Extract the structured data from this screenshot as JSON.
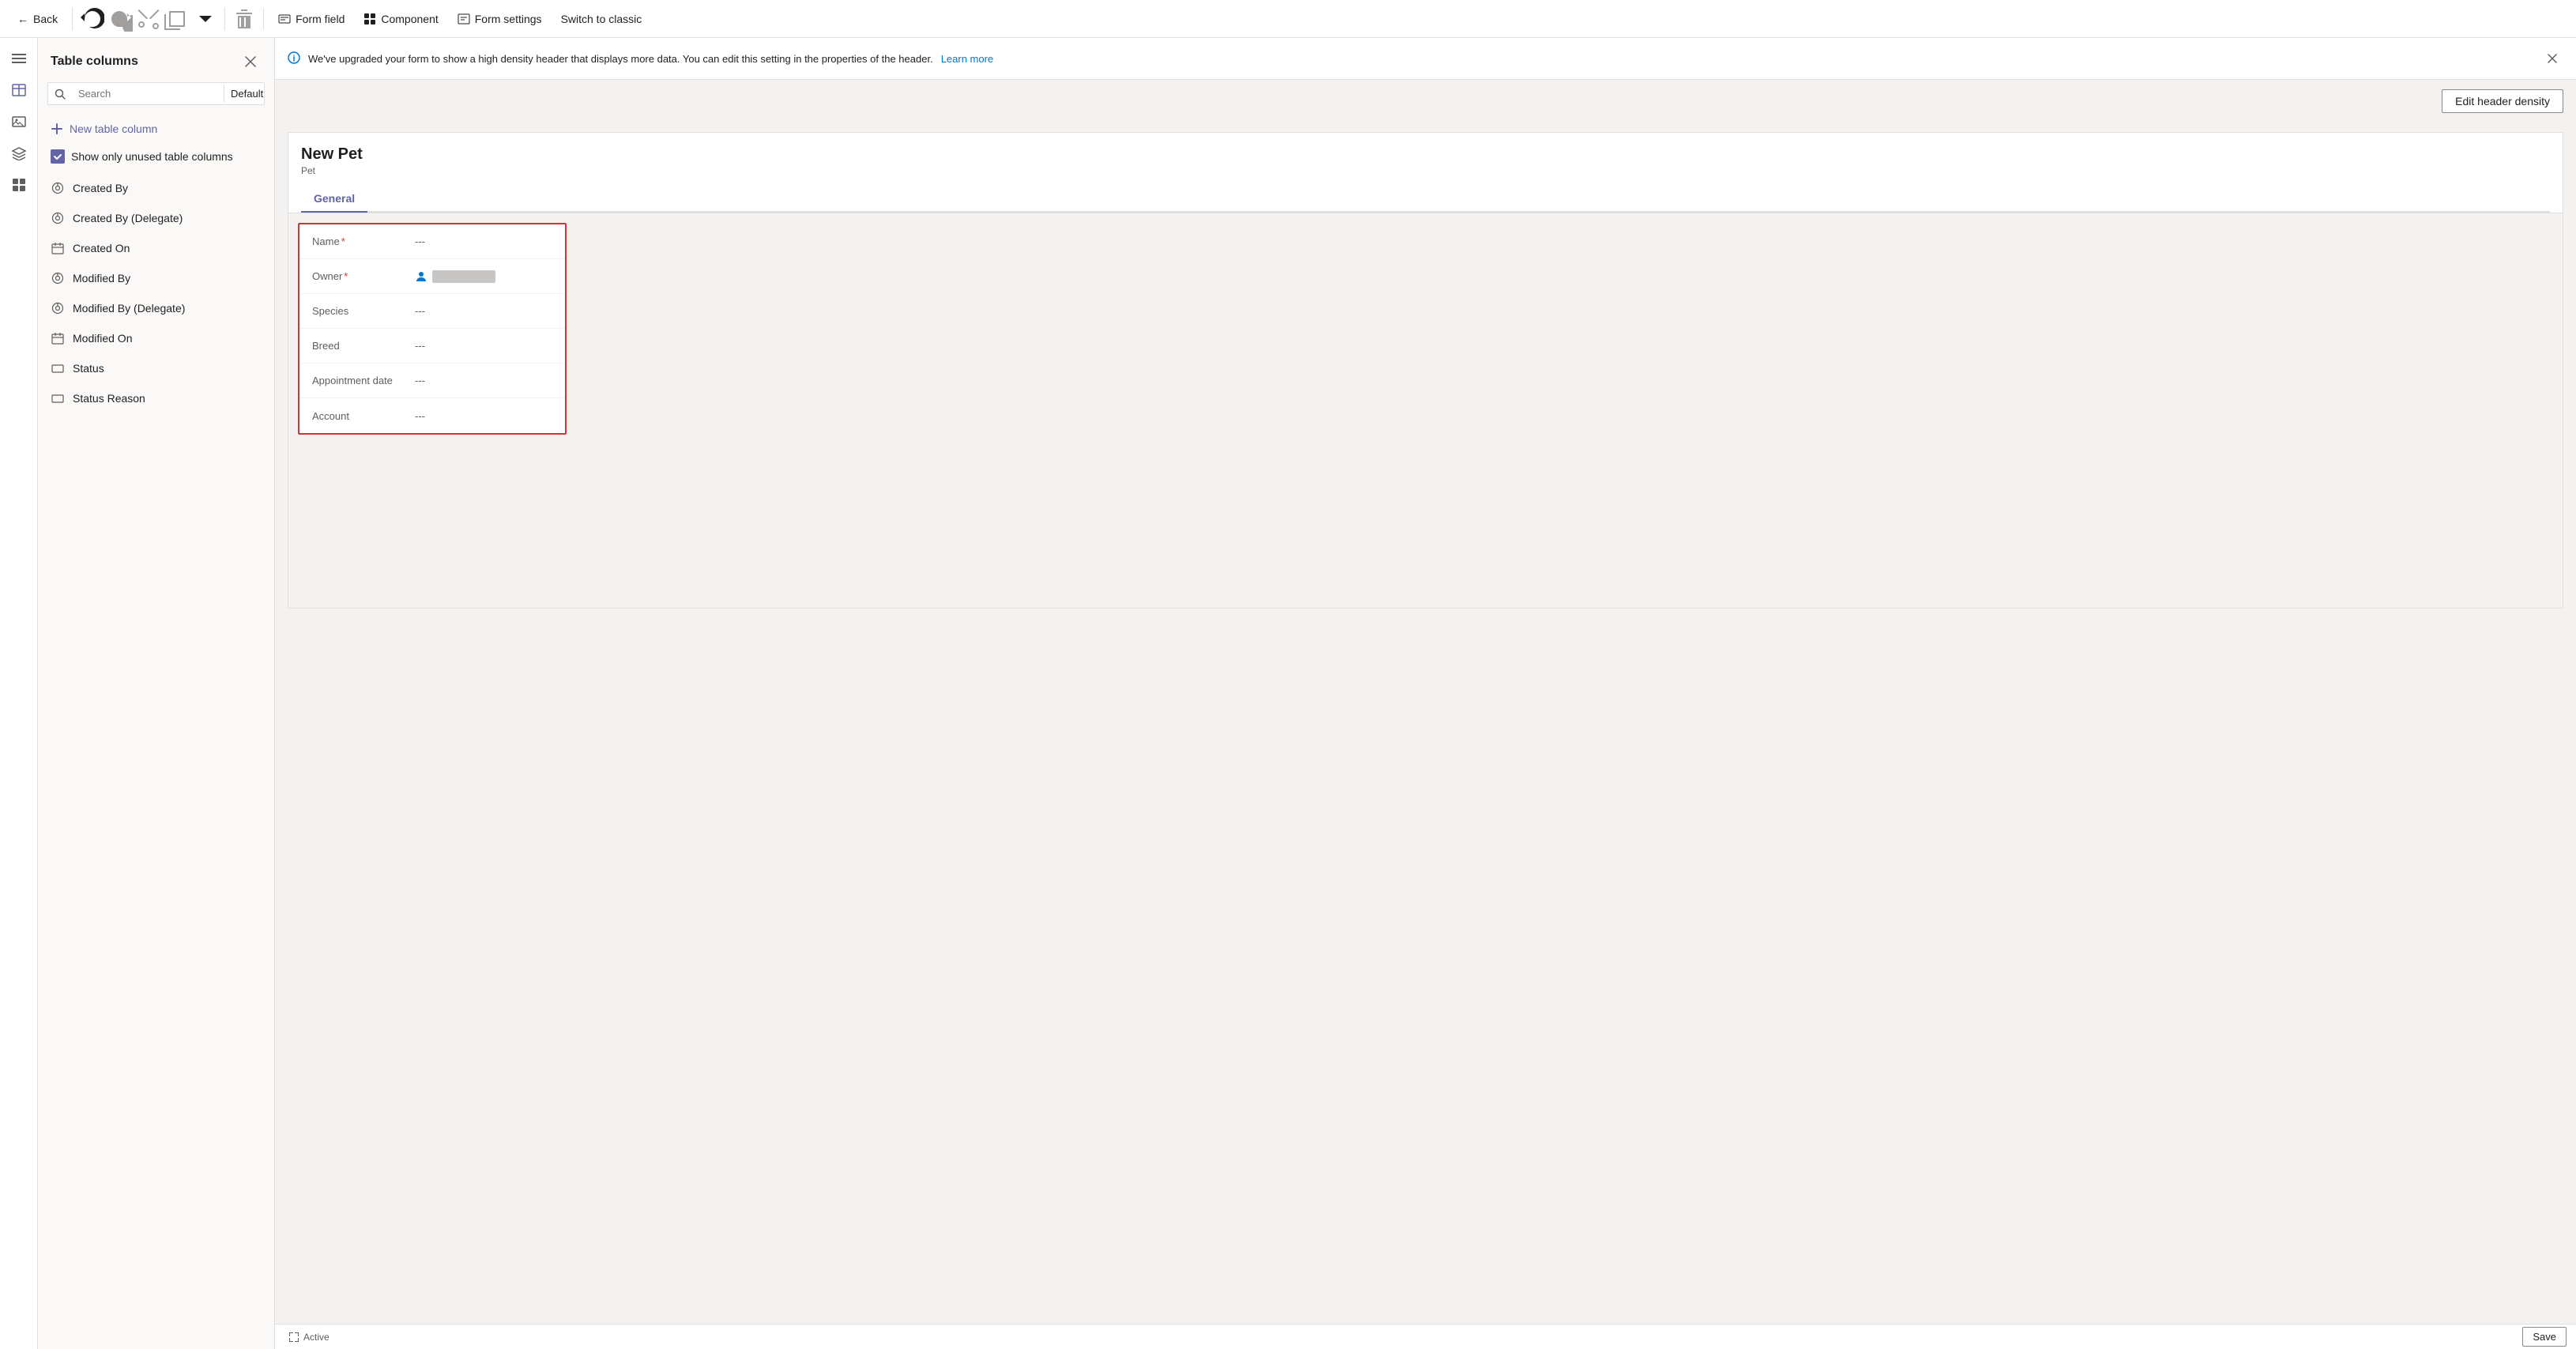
{
  "toolbar": {
    "back_label": "Back",
    "form_field_label": "Form field",
    "component_label": "Component",
    "form_settings_label": "Form settings",
    "switch_label": "Switch to classic"
  },
  "sidebar": {
    "title": "Table columns",
    "search_placeholder": "Search",
    "filter_label": "Default",
    "new_column_label": "New table column",
    "show_unused_label": "Show only unused table columns",
    "items": [
      {
        "label": "Created By",
        "icon": "help-circle"
      },
      {
        "label": "Created By (Delegate)",
        "icon": "help-circle"
      },
      {
        "label": "Created On",
        "icon": "calendar"
      },
      {
        "label": "Modified By",
        "icon": "help-circle"
      },
      {
        "label": "Modified By (Delegate)",
        "icon": "help-circle"
      },
      {
        "label": "Modified On",
        "icon": "calendar"
      },
      {
        "label": "Status",
        "icon": "square"
      },
      {
        "label": "Status Reason",
        "icon": "square"
      }
    ]
  },
  "banner": {
    "text": "We've upgraded your form to show a high density header that displays more data. You can edit this setting in the properties of the header.",
    "link_text": "Learn more"
  },
  "header_density_btn": "Edit header density",
  "form": {
    "title": "New Pet",
    "subtitle": "Pet",
    "tab": "General",
    "fields": [
      {
        "label": "Name",
        "required": true,
        "value": "---"
      },
      {
        "label": "Owner",
        "required": true,
        "value": "owner",
        "type": "owner"
      },
      {
        "label": "Species",
        "required": false,
        "value": "---"
      },
      {
        "label": "Breed",
        "required": false,
        "value": "---"
      },
      {
        "label": "Appointment date",
        "required": false,
        "value": "---"
      },
      {
        "label": "Account",
        "required": false,
        "value": "---"
      }
    ]
  },
  "status_bar": {
    "status": "Active",
    "save_label": "Save"
  },
  "icons": {
    "back": "←",
    "undo": "↩",
    "redo": "↪",
    "cut": "✂",
    "copy": "⧉",
    "delete": "🗑",
    "plus": "+",
    "chevron_down": "▾",
    "search": "🔍",
    "close": "✕",
    "check": "✓",
    "info": "ℹ",
    "expand": "⤢",
    "form_field": "▤",
    "component": "⊞",
    "settings": "⚙",
    "hamburger": "☰",
    "layers": "◫",
    "table": "⊟",
    "grid": "⊞",
    "person": "👤",
    "calendar": "📅",
    "square": "▭",
    "help": "?"
  }
}
